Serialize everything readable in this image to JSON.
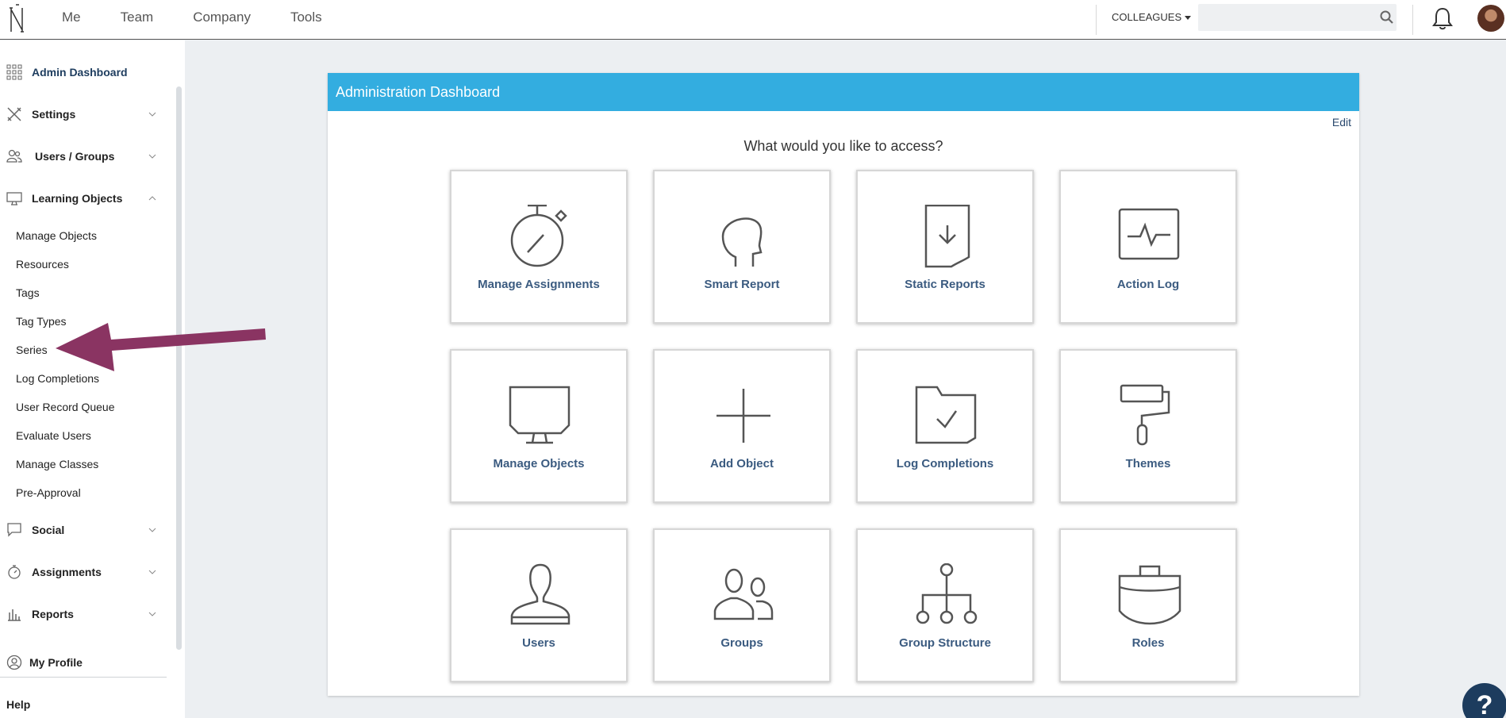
{
  "topbar": {
    "nav": [
      "Me",
      "Team",
      "Company",
      "Tools"
    ],
    "colleagues_label": "COLLEAGUES",
    "search_placeholder": ""
  },
  "sidebar": {
    "admin_dashboard": "Admin Dashboard",
    "settings": "Settings",
    "users_groups": "Users / Groups",
    "learning_objects": "Learning Objects",
    "learning_objects_items": [
      "Manage Objects",
      "Resources",
      "Tags",
      "Tag Types",
      "Series",
      "Log Completions",
      "User Record Queue",
      "Evaluate Users",
      "Manage Classes",
      "Pre-Approval"
    ],
    "social": "Social",
    "assignments": "Assignments",
    "reports": "Reports",
    "my_profile": "My Profile",
    "help": "Help"
  },
  "panel": {
    "title": "Administration Dashboard",
    "edit_label": "Edit",
    "question": "What would you like to access?",
    "tiles": [
      {
        "label": "Manage Assignments",
        "icon": "stopwatch-icon"
      },
      {
        "label": "Smart Report",
        "icon": "head-profile-icon"
      },
      {
        "label": "Static Reports",
        "icon": "document-download-icon"
      },
      {
        "label": "Action Log",
        "icon": "pulse-monitor-icon"
      },
      {
        "label": "Manage Objects",
        "icon": "monitor-icon"
      },
      {
        "label": "Add Object",
        "icon": "plus-icon"
      },
      {
        "label": "Log Completions",
        "icon": "folder-check-icon"
      },
      {
        "label": "Themes",
        "icon": "paint-roller-icon"
      },
      {
        "label": "Users",
        "icon": "user-icon"
      },
      {
        "label": "Groups",
        "icon": "users-icon"
      },
      {
        "label": "Group Structure",
        "icon": "org-chart-icon"
      },
      {
        "label": "Roles",
        "icon": "briefcase-icon"
      }
    ]
  },
  "help_button": "?",
  "colors": {
    "header_blue": "#33ade0",
    "tile_label": "#3b5b80",
    "arrow": "#8a3462",
    "help_fab": "#1d3c5e"
  }
}
